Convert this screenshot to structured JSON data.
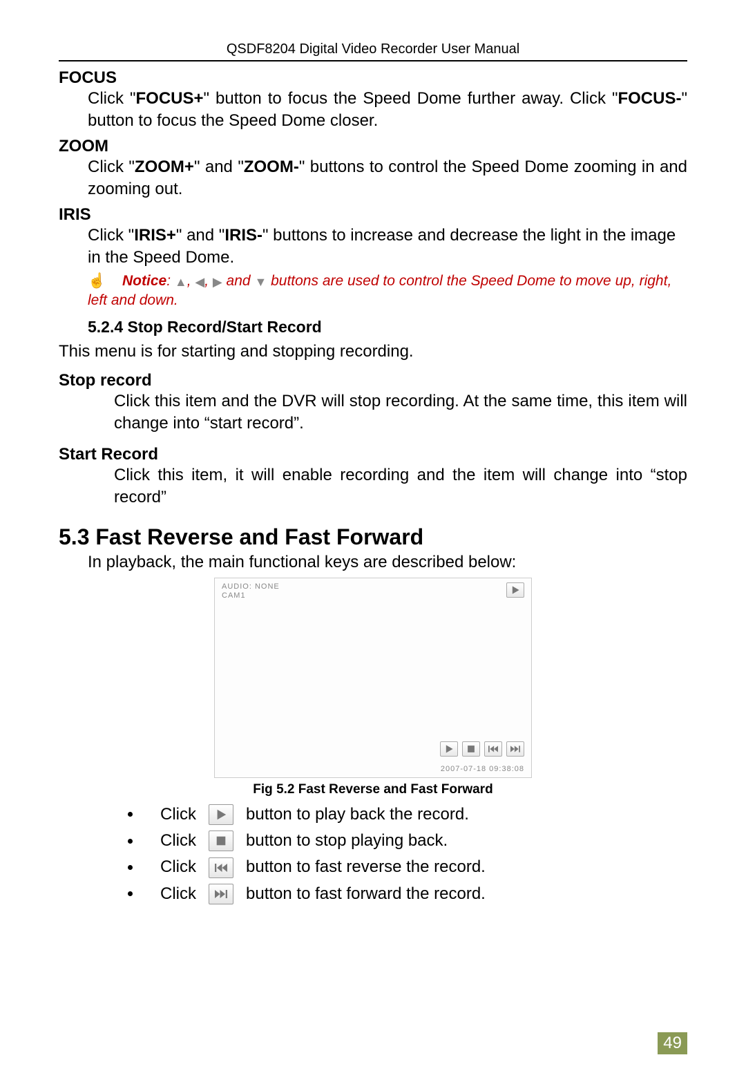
{
  "header": "QSDF8204 Digital Video Recorder User Manual",
  "focus": {
    "title": "FOCUS",
    "text_pre": "Click \"",
    "b1": "FOCUS+",
    "text_mid1": "\" button to focus the Speed Dome further away. Click \"",
    "b2": "FOCUS-",
    "text_end": "\" button to focus the Speed Dome closer."
  },
  "zoom": {
    "title": "ZOOM",
    "text_pre": "Click \"",
    "b1": "ZOOM+",
    "text_mid1": "\" and \"",
    "b2": "ZOOM-",
    "text_end": "\" buttons to control the Speed Dome zooming in and zooming out."
  },
  "iris": {
    "title": "IRIS",
    "text_pre": "Click \"",
    "b1": "IRIS+",
    "text_mid1": "\" and \"",
    "b2": "IRIS-",
    "text_end": "\" buttons to increase and decrease the light in the image in the Speed Dome."
  },
  "notice": {
    "label": "Notice",
    "sep1": ": ",
    "sep2": ", ",
    "sep3": ", ",
    "sep4": " and ",
    "tail": " buttons are used to control the Speed Dome to move up, right, left and down."
  },
  "s524": {
    "title": "5.2.4 Stop Record/Start Record",
    "intro": "This menu is for starting and stopping recording.",
    "stop_title": "Stop record",
    "stop_body": "Click this item and the DVR will stop recording. At the same time, this item will change into “start record”.",
    "start_title": "Start Record",
    "start_body": "Click this item, it will enable recording and the item will change into “stop record”"
  },
  "s53": {
    "title": "5.3 Fast Reverse and Fast Forward",
    "intro": "In playback, the main functional keys are described below:",
    "fig_caption": "Fig 5.2 Fast Reverse and Fast Forward",
    "screenshot": {
      "audio": "AUDIO: NONE",
      "cam": "CAM1",
      "timestamp": "2007-07-18   09:38:08"
    },
    "bullets": [
      {
        "pre": "Click ",
        "post": " button to play back the record.",
        "icon": "play"
      },
      {
        "pre": "Click ",
        "post": " button to stop playing back.",
        "icon": "stop"
      },
      {
        "pre": "Click ",
        "post": " button to fast reverse the record.",
        "icon": "frev"
      },
      {
        "pre": "Click ",
        "post": " button to fast forward the record.",
        "icon": "ffwd"
      }
    ]
  },
  "page_number": "49"
}
